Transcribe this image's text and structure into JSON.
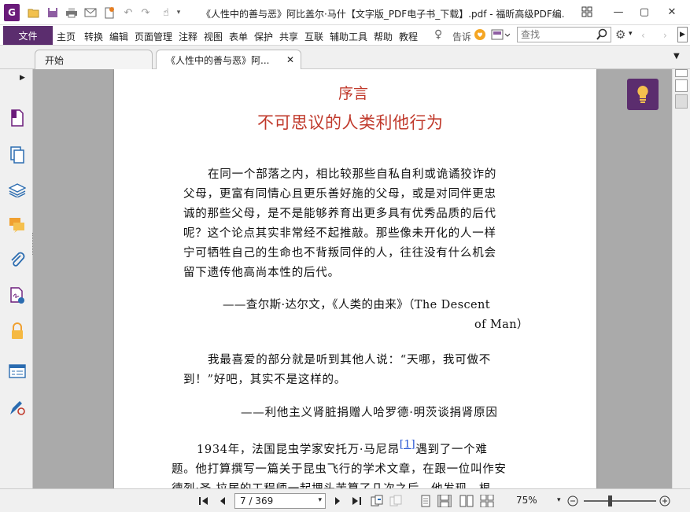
{
  "window": {
    "title": "《人性中的善与恶》阿比盖尔·马什【文字版_PDF电子书_下载】.pdf - 福昕高级PDF编...",
    "app_logo": "G"
  },
  "menu": {
    "file": "文件",
    "items": [
      "主页",
      "转换",
      "编辑",
      "页面管理",
      "注释",
      "视图",
      "表单",
      "保护",
      "共享",
      "互联",
      "辅助工具",
      "帮助",
      "教程"
    ],
    "tell_me": "告诉",
    "search_placeholder": "查找"
  },
  "tabs": [
    {
      "label": "开始"
    },
    {
      "label": "《人性中的善与恶》阿..."
    }
  ],
  "document": {
    "heading": "序言",
    "title": "不可思议的人类利他行为",
    "para1": [
      "在同一个部落之内，相比较那些自私自利或诡谲狡诈的",
      "父母，更富有同情心且更乐善好施的父母，或是对同伴更忠",
      "诚的那些父母，是不是能够养育出更多具有优秀品质的后代",
      "呢？这个论点其实非常经不起推敲。那些像未开化的人一样",
      "宁可牺牲自己的生命也不背叛同伴的人，往往没有什么机会",
      "留下遗传他高尚本性的后代。"
    ],
    "attrib1_line1": "——查尔斯·达尔文，《人类的由来》（The Descent",
    "attrib1_line2": "of Man）",
    "para2": [
      "我最喜爱的部分就是听到其他人说：“天哪，我可做不",
      "到！”好吧，其实不是这样的。"
    ],
    "attrib2": "——利他主义肾脏捐赠人哈罗德·明茨谈捐肾原因",
    "body_line1_a": "1934年，法国昆虫学家安托万·马尼昂",
    "footnote": "[1]",
    "body_line1_b": "遇到了一个难",
    "body_line2": "题。他打算撰写一篇关于昆虫飞行的学术文章，在跟一位叫作安",
    "body_line3": "德烈·圣-拉居的工程师一起埋头苦算了几次之后，他发现，根"
  },
  "status": {
    "page_display": "7 / 369",
    "zoom": "75%",
    "zoom_level_fraction": 0.36
  },
  "colors": {
    "brand": "#5b2d6e",
    "heading": "#c0392b",
    "accent_icon": "#6a1b7a"
  }
}
